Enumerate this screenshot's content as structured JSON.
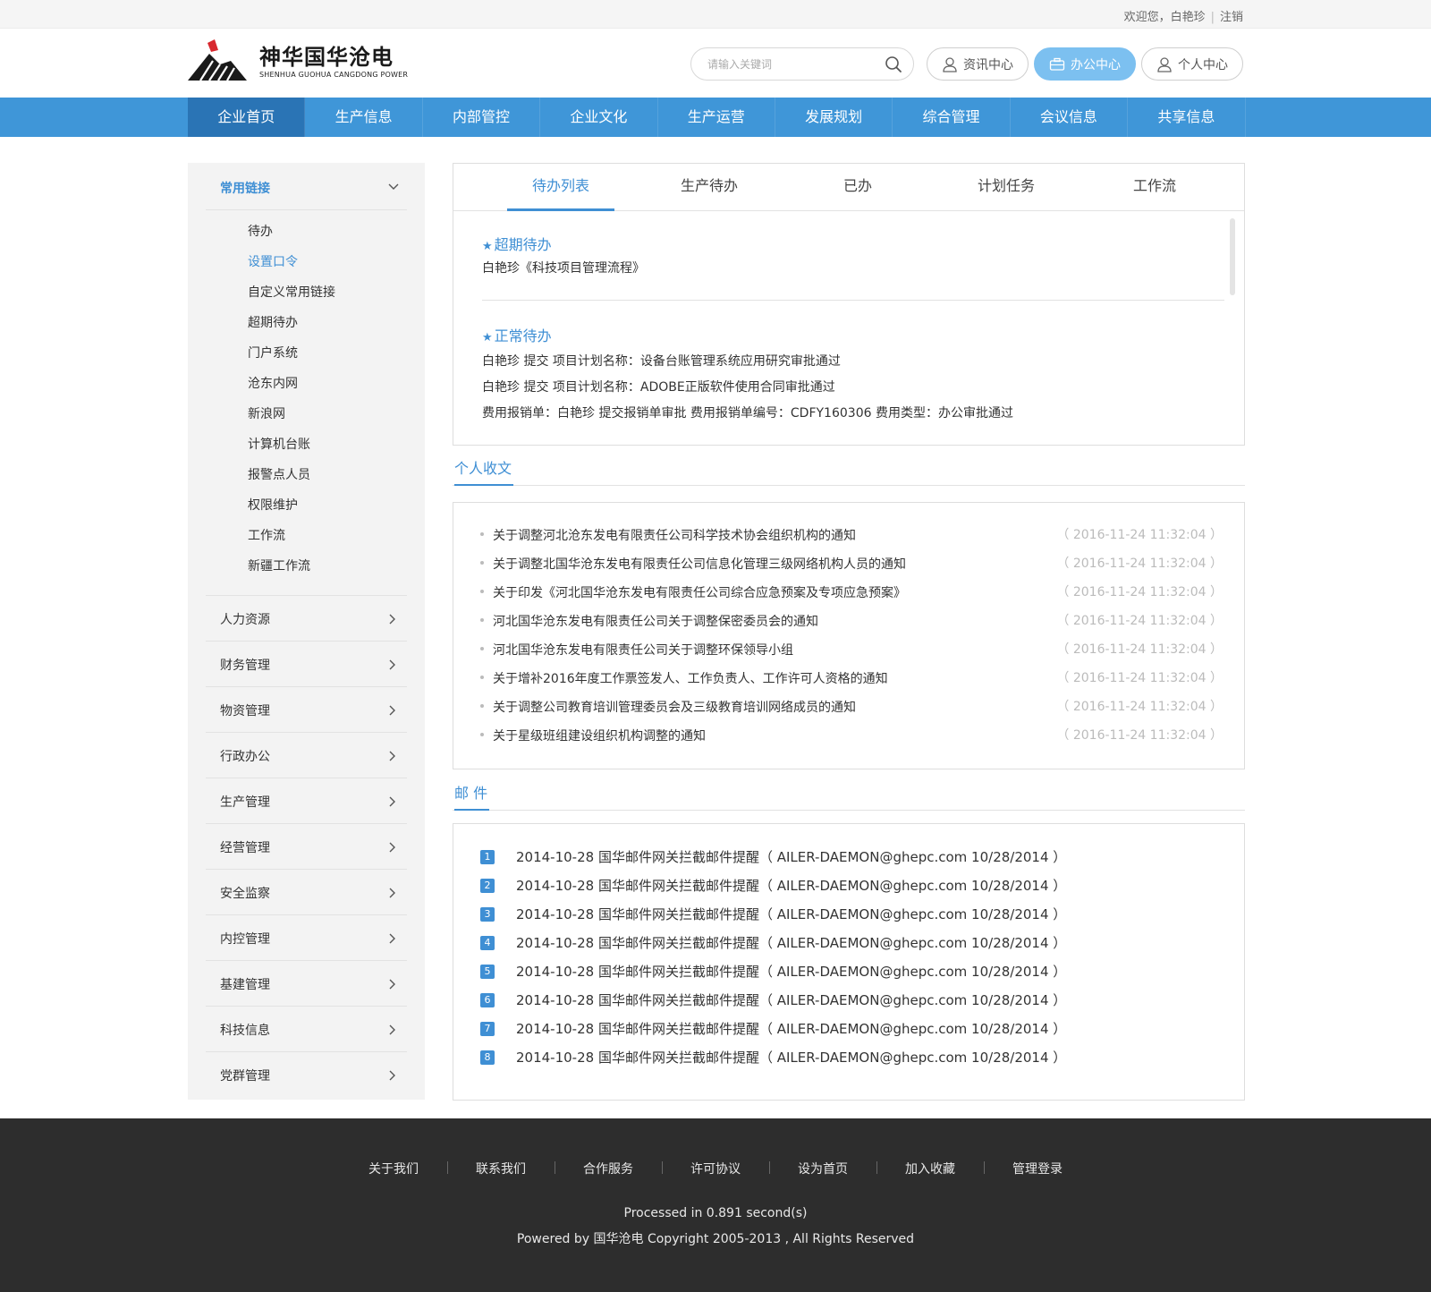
{
  "topbar": {
    "welcome": "欢迎您，白艳珍",
    "logout": "注销"
  },
  "brand": {
    "name_cn": "神华国华沧电",
    "name_en": "SHENHUA GUOHUA CANGDONG POWER",
    "logo_color": "#d8282e"
  },
  "search": {
    "placeholder": "请输入关键词",
    "icon": "search-icon"
  },
  "header_buttons": [
    {
      "label": "资讯中心",
      "icon": "user-icon",
      "active": false
    },
    {
      "label": "办公中心",
      "icon": "briefcase-icon",
      "active": true
    },
    {
      "label": "个人中心",
      "icon": "user-icon",
      "active": false
    }
  ],
  "nav": {
    "color": "#3f96d8",
    "items": [
      {
        "label": "企业首页",
        "active": true
      },
      {
        "label": "生产信息"
      },
      {
        "label": "内部管控"
      },
      {
        "label": "企业文化"
      },
      {
        "label": "生产运营"
      },
      {
        "label": "发展规划"
      },
      {
        "label": "综合管理"
      },
      {
        "label": "会议信息"
      },
      {
        "label": "共享信息"
      }
    ]
  },
  "sidebar": {
    "head": "常用链接",
    "sub_items": [
      "待办",
      "设置口令",
      "自定义常用链接",
      "超期待办",
      "门户系统",
      "沧东内网",
      "新浪网",
      "计算机台账",
      "报警点人员",
      "权限维护",
      "工作流",
      "新疆工作流"
    ],
    "active_sub": "设置口令",
    "groups": [
      "人力资源",
      "财务管理",
      "物资管理",
      "行政办公",
      "生产管理",
      "经营管理",
      "安全监察",
      "内控管理",
      "基建管理",
      "科技信息",
      "党群管理"
    ]
  },
  "todo": {
    "tabs": [
      "待办列表",
      "生产待办",
      "已办",
      "计划任务",
      "工作流"
    ],
    "active_tab": "待办列表",
    "overdue": {
      "title": "超期待办",
      "items": [
        "白艳珍《科技项目管理流程》"
      ]
    },
    "normal": {
      "title": "正常待办",
      "items": [
        "白艳珍 提交 项目计划名称：设备台账管理系统应用研究审批通过",
        "白艳珍 提交 项目计划名称：ADOBE正版软件使用合同审批通过",
        "费用报销单：白艳珍 提交报销单审批 费用报销单编号：CDFY160306 费用类型：办公审批通过"
      ]
    }
  },
  "docs": {
    "title": "个人收文",
    "items": [
      {
        "title": "关于调整河北沧东发电有限责任公司科学技术协会组织机构的通知",
        "time": "（ 2016-11-24  11:32:04 ）"
      },
      {
        "title": "关于调整北国华沧东发电有限责任公司信息化管理三级网络机构人员的通知",
        "time": "（ 2016-11-24  11:32:04 ）"
      },
      {
        "title": "关于印发《河北国华沧东发电有限责任公司综合应急预案及专项应急预案》",
        "time": "（ 2016-11-24  11:32:04 ）"
      },
      {
        "title": "河北国华沧东发电有限责任公司关于调整保密委员会的通知",
        "time": "（ 2016-11-24  11:32:04 ）"
      },
      {
        "title": "河北国华沧东发电有限责任公司关于调整环保领导小组",
        "time": "（ 2016-11-24  11:32:04 ）"
      },
      {
        "title": "关于增补2016年度工作票签发人、工作负责人、工作许可人资格的通知",
        "time": "（ 2016-11-24  11:32:04 ）"
      },
      {
        "title": "关于调整公司教育培训管理委员会及三级教育培训网络成员的通知",
        "time": "（ 2016-11-24  11:32:04 ）"
      },
      {
        "title": "关于星级班组建设组织机构调整的通知",
        "time": "（ 2016-11-24  11:32:04 ）"
      }
    ]
  },
  "mail": {
    "title": "邮 件",
    "items": [
      {
        "num": "1",
        "text": "2014-10-28   国华邮件网关拦截邮件提醒（ AILER-DAEMON@ghepc.com 10/28/2014 ）"
      },
      {
        "num": "2",
        "text": "2014-10-28   国华邮件网关拦截邮件提醒（ AILER-DAEMON@ghepc.com 10/28/2014 ）"
      },
      {
        "num": "3",
        "text": "2014-10-28   国华邮件网关拦截邮件提醒（ AILER-DAEMON@ghepc.com 10/28/2014 ）"
      },
      {
        "num": "4",
        "text": "2014-10-28   国华邮件网关拦截邮件提醒（ AILER-DAEMON@ghepc.com 10/28/2014 ）"
      },
      {
        "num": "5",
        "text": "2014-10-28   国华邮件网关拦截邮件提醒（ AILER-DAEMON@ghepc.com 10/28/2014 ）"
      },
      {
        "num": "6",
        "text": "2014-10-28   国华邮件网关拦截邮件提醒（ AILER-DAEMON@ghepc.com 10/28/2014 ）"
      },
      {
        "num": "7",
        "text": "2014-10-28   国华邮件网关拦截邮件提醒（ AILER-DAEMON@ghepc.com 10/28/2014 ）"
      },
      {
        "num": "8",
        "text": "2014-10-28   国华邮件网关拦截邮件提醒（ AILER-DAEMON@ghepc.com 10/28/2014 ）"
      }
    ]
  },
  "footer": {
    "links": [
      "关于我们",
      "联系我们",
      "合作服务",
      "许可协议",
      "设为首页",
      "加入收藏",
      "管理登录"
    ],
    "processed": "Processed in 0.891 second(s)",
    "copyright": "Powered by 国华沧电  Copyright    2005-2013 , All Rights Reserved"
  }
}
